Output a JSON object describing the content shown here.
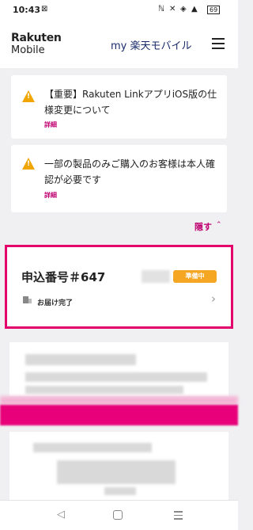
{
  "status_bar": {
    "time": "10:43",
    "battery": "69"
  },
  "header": {
    "logo_line1": "Rakuten",
    "logo_line2": "Mobile",
    "title": "my 楽天モバイル"
  },
  "notices": [
    {
      "text": "【重要】Rakuten LinkアプリiOS版の仕様変更について",
      "link": "詳細"
    },
    {
      "text": "一部の製品のみご購入のお客様は本人確認が必要です",
      "link": "詳細"
    }
  ],
  "hide_label": "隠す",
  "order": {
    "number_label": "申込番号＃647",
    "status_badge": "準備中",
    "delivery_status": "お届け完了"
  },
  "colors": {
    "accent": "#bf0070",
    "border": "#e3006d",
    "badge": "#f5a623",
    "warning": "#f0a500"
  }
}
